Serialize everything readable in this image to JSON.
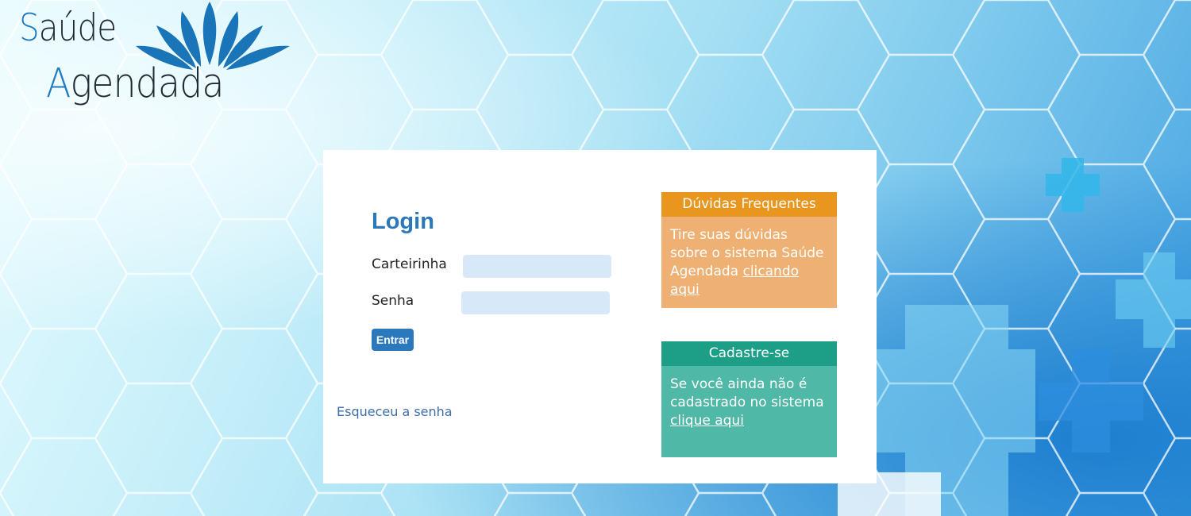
{
  "brand": {
    "line1_cap": "S",
    "line1_rest": "aúde",
    "line2_cap": "A",
    "line2_rest": "gendada"
  },
  "login": {
    "title": "Login",
    "card_label": "Carteirinha",
    "card_value": "",
    "password_label": "Senha",
    "password_value": "",
    "submit_label": "Entrar",
    "forgot_link": "Esqueceu a senha"
  },
  "faq_box": {
    "title": "Dúvidas Frequentes",
    "text": "Tire suas dúvidas sobre o sistema Saúde Agendada ",
    "link": "clicando aqui"
  },
  "register_box": {
    "title": "Cadastre-se",
    "text": "Se você ainda não é cadastrado no sistema ",
    "link": "clique aqui"
  },
  "colors": {
    "brand_blue": "#2b78bc",
    "faq_header": "#e8961d",
    "faq_body": "#eeb073",
    "register_header": "#1c9f86",
    "register_body": "#50b8a6"
  }
}
